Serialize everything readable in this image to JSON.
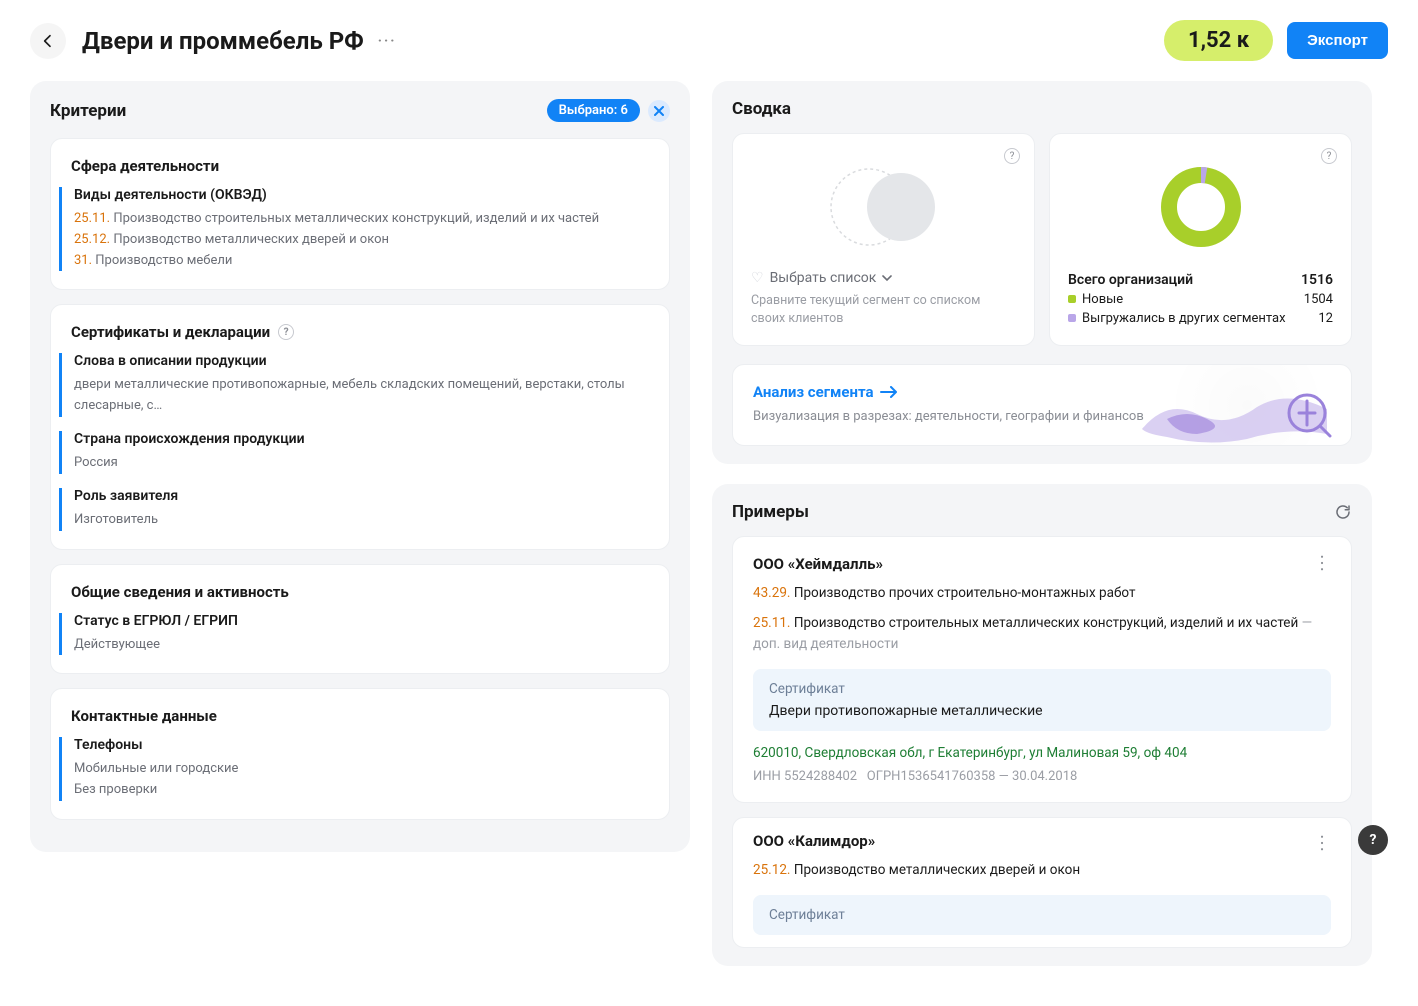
{
  "header": {
    "title": "Двери и проммебель РФ",
    "count": "1,52 к",
    "export_label": "Экспорт"
  },
  "criteria": {
    "title": "Критерии",
    "selected_label": "Выбрано: 6",
    "groups": [
      {
        "title": "Сфера деятельности",
        "blocks": [
          {
            "label": "Виды деятельности (ОКВЭД)",
            "lines": [
              {
                "code": "25.11.",
                "text": "Производство строительных металлических конструкций, изделий и их частей"
              },
              {
                "code": "25.12.",
                "text": "Производство металлических дверей и окон"
              },
              {
                "code": "31.",
                "text": "Производство мебели"
              }
            ]
          }
        ]
      },
      {
        "title": "Сертификаты и декларации",
        "help": true,
        "blocks": [
          {
            "label": "Слова в описании продукции",
            "text": "двери металлические противопожарные, мебель складских помещений, верстаки, столы слесарные, с…"
          },
          {
            "label": "Страна происхождения продукции",
            "text": "Россия"
          },
          {
            "label": "Роль заявителя",
            "text": "Изготовитель"
          }
        ]
      },
      {
        "title": "Общие сведения и активность",
        "blocks": [
          {
            "label": "Статус в ЕГРЮЛ / ЕГРИП",
            "text": "Действующее"
          }
        ]
      },
      {
        "title": "Контактные данные",
        "blocks": [
          {
            "label": "Телефоны",
            "lines_plain": [
              "Мобильные или городские",
              "Без проверки"
            ]
          }
        ]
      }
    ]
  },
  "summary": {
    "title": "Сводка",
    "select_list": "Выбрать список",
    "compare_desc": "Сравните текущий сегмент со списком своих клиентов",
    "totals_title": "Всего организаций",
    "totals_value": "1516",
    "new_label": "Новые",
    "new_value": "1504",
    "exported_label": "Выгружались в других сегментах",
    "exported_value": "12",
    "analysis_link": "Анализ сегмента",
    "analysis_desc": "Визуализация в разрезах: деятельности, географии и финансов"
  },
  "examples": {
    "title": "Примеры",
    "items": [
      {
        "name": "ООО «Хеймдалль»",
        "lines": [
          {
            "code": "43.29.",
            "text": "Производство прочих строительно-монтажных работ"
          },
          {
            "code": "25.11.",
            "text": "Производство строительных металлических конструкций, изделий и их частей",
            "suffix": "— доп. вид деятельности"
          }
        ],
        "cert_label": "Сертификат",
        "cert_text": "Двери противопожарные металлические",
        "address": "620010, Свердловская обл, г Екатеринбург, ул Малиновая 59, оф 404",
        "inn": "ИНН 5524288402",
        "ogrn": "ОГРН1536541760358 — 30.04.2018"
      },
      {
        "name": "ООО «Калимдор»",
        "lines": [
          {
            "code": "25.12.",
            "text": "Производство металлических дверей и окон"
          }
        ],
        "cert_label": "Сертификат"
      }
    ]
  },
  "chart_data": {
    "type": "pie",
    "title": "Всего организаций",
    "total": 1516,
    "series": [
      {
        "name": "Новые",
        "value": 1504,
        "color": "#a8cf2a"
      },
      {
        "name": "Выгружались в других сегментах",
        "value": 12,
        "color": "#b9a6e8"
      }
    ]
  }
}
